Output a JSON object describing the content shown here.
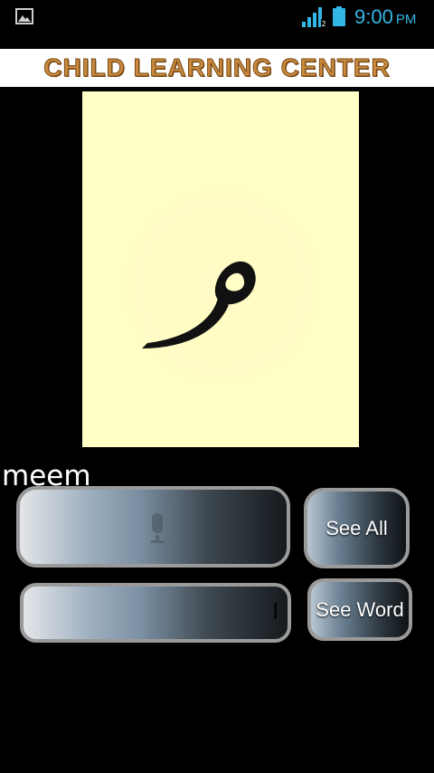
{
  "status_bar": {
    "time": "9:00",
    "ampm": "PM",
    "icons": [
      "gallery-icon",
      "signal-icon",
      "battery-icon"
    ],
    "accent_color": "#33b5e5"
  },
  "header": {
    "title": "CHILD LEARNING CENTER"
  },
  "card": {
    "letter": "م",
    "background_color": "#ffffc6"
  },
  "letter_name": "meem",
  "mic_panel": {
    "icon": "microphone-icon"
  },
  "answer_field": {
    "value": "ا"
  },
  "buttons": {
    "see_all": "See All",
    "see_word": "See Word"
  }
}
